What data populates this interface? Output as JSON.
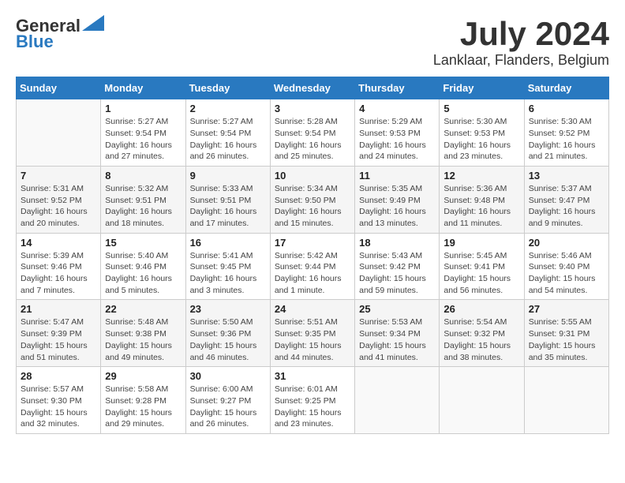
{
  "logo": {
    "line1": "General",
    "line2": "Blue"
  },
  "title": "July 2024",
  "subtitle": "Lanklaar, Flanders, Belgium",
  "headers": [
    "Sunday",
    "Monday",
    "Tuesday",
    "Wednesday",
    "Thursday",
    "Friday",
    "Saturday"
  ],
  "weeks": [
    [
      {
        "day": "",
        "info": ""
      },
      {
        "day": "1",
        "info": "Sunrise: 5:27 AM\nSunset: 9:54 PM\nDaylight: 16 hours\nand 27 minutes."
      },
      {
        "day": "2",
        "info": "Sunrise: 5:27 AM\nSunset: 9:54 PM\nDaylight: 16 hours\nand 26 minutes."
      },
      {
        "day": "3",
        "info": "Sunrise: 5:28 AM\nSunset: 9:54 PM\nDaylight: 16 hours\nand 25 minutes."
      },
      {
        "day": "4",
        "info": "Sunrise: 5:29 AM\nSunset: 9:53 PM\nDaylight: 16 hours\nand 24 minutes."
      },
      {
        "day": "5",
        "info": "Sunrise: 5:30 AM\nSunset: 9:53 PM\nDaylight: 16 hours\nand 23 minutes."
      },
      {
        "day": "6",
        "info": "Sunrise: 5:30 AM\nSunset: 9:52 PM\nDaylight: 16 hours\nand 21 minutes."
      }
    ],
    [
      {
        "day": "7",
        "info": "Sunrise: 5:31 AM\nSunset: 9:52 PM\nDaylight: 16 hours\nand 20 minutes."
      },
      {
        "day": "8",
        "info": "Sunrise: 5:32 AM\nSunset: 9:51 PM\nDaylight: 16 hours\nand 18 minutes."
      },
      {
        "day": "9",
        "info": "Sunrise: 5:33 AM\nSunset: 9:51 PM\nDaylight: 16 hours\nand 17 minutes."
      },
      {
        "day": "10",
        "info": "Sunrise: 5:34 AM\nSunset: 9:50 PM\nDaylight: 16 hours\nand 15 minutes."
      },
      {
        "day": "11",
        "info": "Sunrise: 5:35 AM\nSunset: 9:49 PM\nDaylight: 16 hours\nand 13 minutes."
      },
      {
        "day": "12",
        "info": "Sunrise: 5:36 AM\nSunset: 9:48 PM\nDaylight: 16 hours\nand 11 minutes."
      },
      {
        "day": "13",
        "info": "Sunrise: 5:37 AM\nSunset: 9:47 PM\nDaylight: 16 hours\nand 9 minutes."
      }
    ],
    [
      {
        "day": "14",
        "info": "Sunrise: 5:39 AM\nSunset: 9:46 PM\nDaylight: 16 hours\nand 7 minutes."
      },
      {
        "day": "15",
        "info": "Sunrise: 5:40 AM\nSunset: 9:46 PM\nDaylight: 16 hours\nand 5 minutes."
      },
      {
        "day": "16",
        "info": "Sunrise: 5:41 AM\nSunset: 9:45 PM\nDaylight: 16 hours\nand 3 minutes."
      },
      {
        "day": "17",
        "info": "Sunrise: 5:42 AM\nSunset: 9:44 PM\nDaylight: 16 hours\nand 1 minute."
      },
      {
        "day": "18",
        "info": "Sunrise: 5:43 AM\nSunset: 9:42 PM\nDaylight: 15 hours\nand 59 minutes."
      },
      {
        "day": "19",
        "info": "Sunrise: 5:45 AM\nSunset: 9:41 PM\nDaylight: 15 hours\nand 56 minutes."
      },
      {
        "day": "20",
        "info": "Sunrise: 5:46 AM\nSunset: 9:40 PM\nDaylight: 15 hours\nand 54 minutes."
      }
    ],
    [
      {
        "day": "21",
        "info": "Sunrise: 5:47 AM\nSunset: 9:39 PM\nDaylight: 15 hours\nand 51 minutes."
      },
      {
        "day": "22",
        "info": "Sunrise: 5:48 AM\nSunset: 9:38 PM\nDaylight: 15 hours\nand 49 minutes."
      },
      {
        "day": "23",
        "info": "Sunrise: 5:50 AM\nSunset: 9:36 PM\nDaylight: 15 hours\nand 46 minutes."
      },
      {
        "day": "24",
        "info": "Sunrise: 5:51 AM\nSunset: 9:35 PM\nDaylight: 15 hours\nand 44 minutes."
      },
      {
        "day": "25",
        "info": "Sunrise: 5:53 AM\nSunset: 9:34 PM\nDaylight: 15 hours\nand 41 minutes."
      },
      {
        "day": "26",
        "info": "Sunrise: 5:54 AM\nSunset: 9:32 PM\nDaylight: 15 hours\nand 38 minutes."
      },
      {
        "day": "27",
        "info": "Sunrise: 5:55 AM\nSunset: 9:31 PM\nDaylight: 15 hours\nand 35 minutes."
      }
    ],
    [
      {
        "day": "28",
        "info": "Sunrise: 5:57 AM\nSunset: 9:30 PM\nDaylight: 15 hours\nand 32 minutes."
      },
      {
        "day": "29",
        "info": "Sunrise: 5:58 AM\nSunset: 9:28 PM\nDaylight: 15 hours\nand 29 minutes."
      },
      {
        "day": "30",
        "info": "Sunrise: 6:00 AM\nSunset: 9:27 PM\nDaylight: 15 hours\nand 26 minutes."
      },
      {
        "day": "31",
        "info": "Sunrise: 6:01 AM\nSunset: 9:25 PM\nDaylight: 15 hours\nand 23 minutes."
      },
      {
        "day": "",
        "info": ""
      },
      {
        "day": "",
        "info": ""
      },
      {
        "day": "",
        "info": ""
      }
    ]
  ]
}
